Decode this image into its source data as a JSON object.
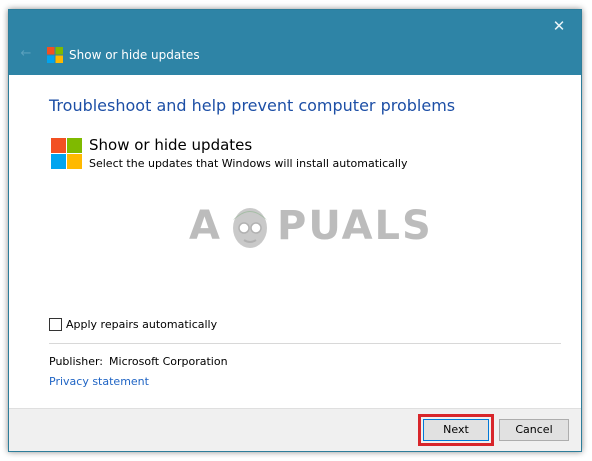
{
  "window": {
    "title": "Show or hide updates",
    "close_glyph": "✕",
    "back_glyph": "←"
  },
  "main": {
    "heading": "Troubleshoot and help prevent computer problems",
    "tool_title": "Show or hide updates",
    "tool_description": "Select the updates that Windows will install automatically",
    "watermark_left": "A",
    "watermark_right": "PUALS"
  },
  "options": {
    "apply_repairs_label": "Apply repairs automatically",
    "apply_repairs_checked": false
  },
  "publisher": {
    "label": "Publisher:",
    "value": "Microsoft Corporation"
  },
  "links": {
    "privacy": "Privacy statement"
  },
  "footer": {
    "next_label": "Next",
    "cancel_label": "Cancel"
  },
  "colors": {
    "titlebar": "#2e84a6",
    "heading": "#1d4fa6",
    "link": "#1f64c4",
    "highlight": "#d8262b",
    "ms_red": "#f25022",
    "ms_green": "#7fba00",
    "ms_blue": "#00a4ef",
    "ms_yellow": "#ffb900"
  },
  "icons": {
    "title_icon": "windows-logo-icon",
    "tool_icon": "windows-logo-icon",
    "close": "close-icon",
    "back": "back-arrow-icon"
  }
}
